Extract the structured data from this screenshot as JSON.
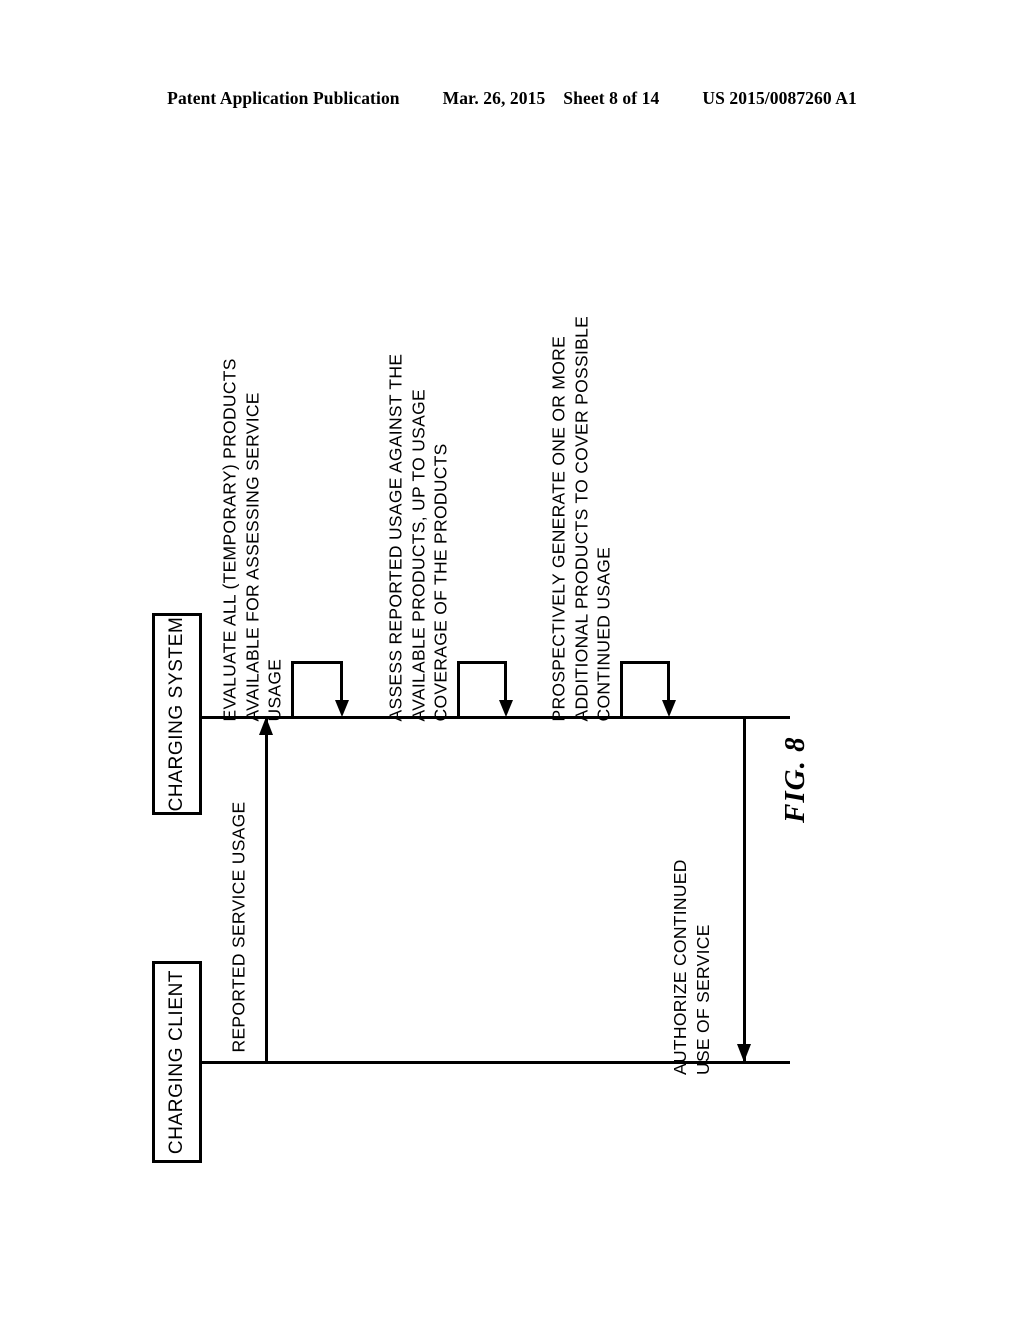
{
  "header": {
    "publication": "Patent Application Publication",
    "date": "Mar. 26, 2015",
    "sheet": "Sheet 8 of 14",
    "doc_number": "US 2015/0087260 A1"
  },
  "figure": {
    "caption": "FIG. 8",
    "type": "sequence-diagram"
  },
  "actors": [
    {
      "id": "charging-system",
      "label": "CHARGING SYSTEM"
    },
    {
      "id": "charging-client",
      "label": "CHARGING CLIENT"
    }
  ],
  "messages": [
    {
      "id": "reported-service-usage",
      "label": "REPORTED SERVICE USAGE",
      "from": "charging-client",
      "to": "charging-system",
      "kind": "straight"
    },
    {
      "id": "evaluate-products",
      "label": "EVALUATE ALL (TEMPORARY) PRODUCTS\nAVAILABLE FOR ASSESSING SERVICE\nUSAGE",
      "from": "charging-system",
      "to": "charging-system",
      "kind": "self-loop"
    },
    {
      "id": "assess-reported-usage",
      "label": "ASSESS REPORTED USAGE AGAINST THE\nAVAILABLE PRODUCTS, UP TO USAGE\nCOVERAGE OF THE PRODUCTS",
      "from": "charging-system",
      "to": "charging-system",
      "kind": "self-loop"
    },
    {
      "id": "prospectively-generate-products",
      "label": "PROSPECTIVELY GENERATE ONE OR MORE\nADDITIONAL PRODUCTS TO COVER POSSIBLE\nCONTINUED USAGE",
      "from": "charging-system",
      "to": "charging-system",
      "kind": "self-loop"
    },
    {
      "id": "authorize-continued-use",
      "label": "AUTHORIZE CONTINUED\nUSE OF SERVICE",
      "from": "charging-system",
      "to": "charging-client",
      "kind": "straight"
    }
  ],
  "colors": {
    "ink": "#000000",
    "paper": "#ffffff"
  }
}
